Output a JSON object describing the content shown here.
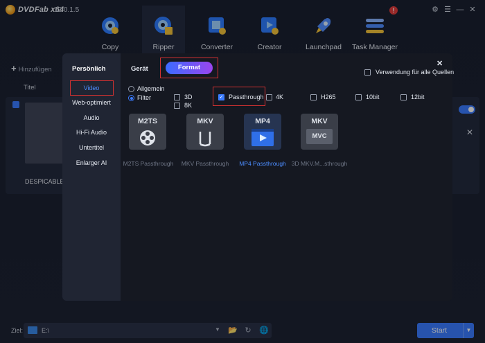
{
  "titlebar": {
    "brand": "DVDFab x64",
    "version": "12.0.1.5",
    "notification_count": "!"
  },
  "nav": [
    {
      "label": "Copy",
      "icon": "copy-disc-icon"
    },
    {
      "label": "Ripper",
      "icon": "ripper-disc-icon"
    },
    {
      "label": "Converter",
      "icon": "converter-film-icon"
    },
    {
      "label": "Creator",
      "icon": "creator-film-icon"
    },
    {
      "label": "Launchpad",
      "icon": "rocket-icon"
    },
    {
      "label": "Task Manager",
      "icon": "task-list-icon"
    }
  ],
  "main": {
    "add_label": "Hinzufügen",
    "title_col": "Titel",
    "movie_title": "DESPICABLE"
  },
  "bottom": {
    "ziel_label": "Ziel:",
    "path": "E:\\",
    "start_label": "Start"
  },
  "modal": {
    "sidebar_title": "Persönlich",
    "sidebar_items": [
      "Video",
      "Web-optimiert",
      "Audio",
      "Hi-Fi Audio",
      "Untertitel",
      "Enlarger AI"
    ],
    "tabs": {
      "geraet": "Gerät",
      "format": "Format"
    },
    "apply_all": "Verwendung für alle Quellen",
    "radios": {
      "allgemein": "Allgemein",
      "filter": "Filter"
    },
    "checkboxes": {
      "d3": "3D",
      "k8": "8K",
      "passthrough": "Passthrough",
      "k4": "4K",
      "h265": "H265",
      "bit10": "10bit",
      "bit12": "12bit"
    },
    "formats": [
      {
        "top": "M2TS",
        "label": "M2TS Passthrough"
      },
      {
        "top": "MKV",
        "label": "MKV Passthrough"
      },
      {
        "top": "MP4",
        "label": "MP4 Passthrough"
      },
      {
        "top": "MKV",
        "sub": "MVC",
        "label": "3D MKV.M...sthrough"
      }
    ]
  },
  "colors": {
    "accent": "#3a7bff",
    "highlight": "#d43131",
    "modal_bg": "#151821"
  }
}
